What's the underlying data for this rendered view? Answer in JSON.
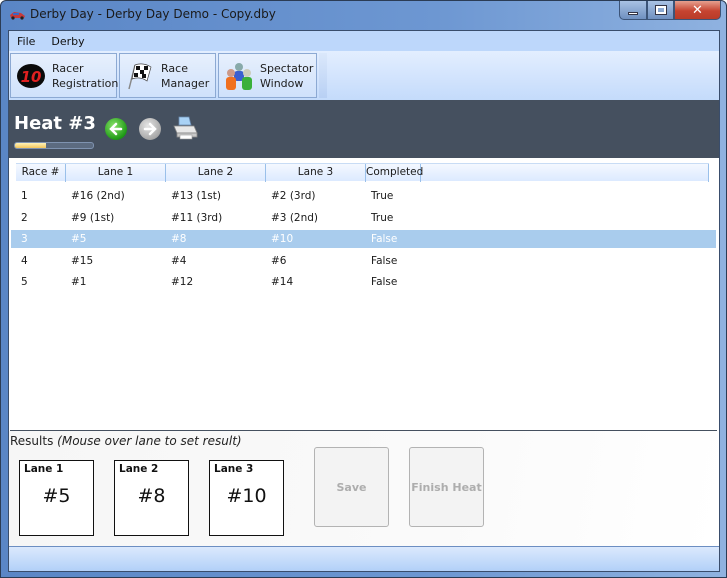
{
  "window": {
    "title": "Derby Day - Derby Day Demo - Copy.dby",
    "app_icon": "race-car-icon",
    "controls": [
      "minimize",
      "maximize",
      "close"
    ]
  },
  "menu": {
    "items": [
      {
        "label": "File"
      },
      {
        "label": "Derby"
      }
    ]
  },
  "toolbar": {
    "buttons": [
      {
        "line1": "Racer",
        "line2": "Registration",
        "icon": "car-number-10-icon"
      },
      {
        "line1": "Race",
        "line2": "Manager",
        "icon": "checkered-flag-icon"
      },
      {
        "line1": "Spectator",
        "line2": "Window",
        "icon": "people-icon"
      }
    ]
  },
  "heat": {
    "title": "Heat #3",
    "progress_fraction": 0.4,
    "back_icon": "arrow-left-icon",
    "forward_icon": "arrow-right-icon",
    "print_icon": "printer-icon"
  },
  "grid": {
    "columns": [
      "Race #",
      "Lane 1",
      "Lane 2",
      "Lane 3",
      "Completed"
    ],
    "rows": [
      [
        "1",
        "#16 (2nd)",
        "#13 (1st)",
        "#2 (3rd)",
        "True"
      ],
      [
        "2",
        "#9 (1st)",
        "#11 (3rd)",
        "#3 (2nd)",
        "True"
      ],
      [
        "3",
        "#5",
        "#8",
        "#10",
        "False"
      ],
      [
        "4",
        "#15",
        "#4",
        "#6",
        "False"
      ],
      [
        "5",
        "#1",
        "#12",
        "#14",
        "False"
      ]
    ],
    "selected_row_index": 2,
    "selection_color": "#a9cced"
  },
  "results": {
    "label": "Results",
    "hint": "(Mouse over lane to set result)",
    "lanes": [
      {
        "title": "Lane 1",
        "racer": "#5"
      },
      {
        "title": "Lane 2",
        "racer": "#8"
      },
      {
        "title": "Lane 3",
        "racer": "#10"
      }
    ],
    "save_label": "Save",
    "finish_label": "Finish Heat"
  }
}
